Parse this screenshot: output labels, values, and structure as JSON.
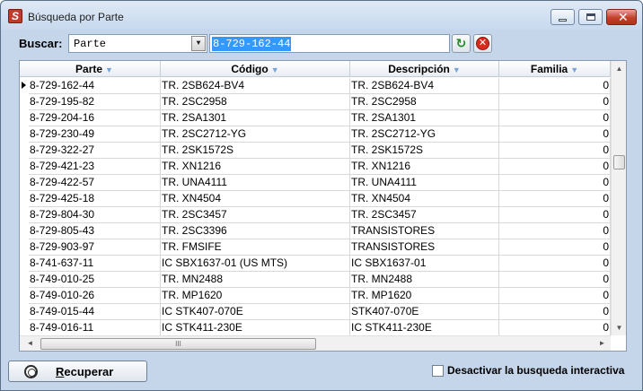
{
  "window": {
    "title": "Búsqueda por Parte",
    "app_icon_glyph": "S",
    "close_glyph": "✕"
  },
  "search": {
    "label": "Buscar:",
    "field_selected": "Parte",
    "query": "8-729-162-44",
    "dropdown_arrow": "▼",
    "refresh_glyph": "↻",
    "cancel_glyph": "✕"
  },
  "grid": {
    "columns": [
      "Parte",
      "Código",
      "Descripción",
      "Familia"
    ],
    "sort_glyph": "▼",
    "selected_row_index": 0,
    "rows": [
      [
        "8-729-162-44",
        "TR. 2SB624-BV4",
        "TR. 2SB624-BV4",
        "0"
      ],
      [
        "8-729-195-82",
        "TR. 2SC2958",
        "TR. 2SC2958",
        "0"
      ],
      [
        "8-729-204-16",
        "TR. 2SA1301",
        "TR. 2SA1301",
        "0"
      ],
      [
        "8-729-230-49",
        "TR. 2SC2712-YG",
        "TR. 2SC2712-YG",
        "0"
      ],
      [
        "8-729-322-27",
        "TR. 2SK1572S",
        "TR. 2SK1572S",
        "0"
      ],
      [
        "8-729-421-23",
        "TR. XN1216",
        "TR. XN1216",
        "0"
      ],
      [
        "8-729-422-57",
        "TR. UNA4111",
        "TR. UNA4111",
        "0"
      ],
      [
        "8-729-425-18",
        "TR. XN4504",
        "TR. XN4504",
        "0"
      ],
      [
        "8-729-804-30",
        "TR. 2SC3457",
        "TR. 2SC3457",
        "0"
      ],
      [
        "8-729-805-43",
        "TR. 2SC3396",
        "TRANSISTORES",
        "0"
      ],
      [
        "8-729-903-97",
        "TR. FMSIFE",
        "TRANSISTORES",
        "0"
      ],
      [
        "8-741-637-11",
        "IC SBX1637-01 (US MTS)",
        "IC SBX1637-01",
        "0"
      ],
      [
        "8-749-010-25",
        "TR. MN2488",
        "TR. MN2488",
        "0"
      ],
      [
        "8-749-010-26",
        "TR. MP1620",
        "TR. MP1620",
        "0"
      ],
      [
        "8-749-015-44",
        "IC STK407-070E",
        "STK407-070E",
        "0"
      ],
      [
        "8-749-016-11",
        "IC STK411-230E",
        "IC STK411-230E",
        "0"
      ]
    ],
    "scroll": {
      "up": "▲",
      "down": "▼",
      "left": "◄",
      "right": "►",
      "h_grip": "III"
    }
  },
  "footer": {
    "recover_label": "Recuperar",
    "recover_accesskey": "R",
    "checkbox_label": "Desactivar la busqueda interactiva",
    "checkbox_checked": false
  }
}
